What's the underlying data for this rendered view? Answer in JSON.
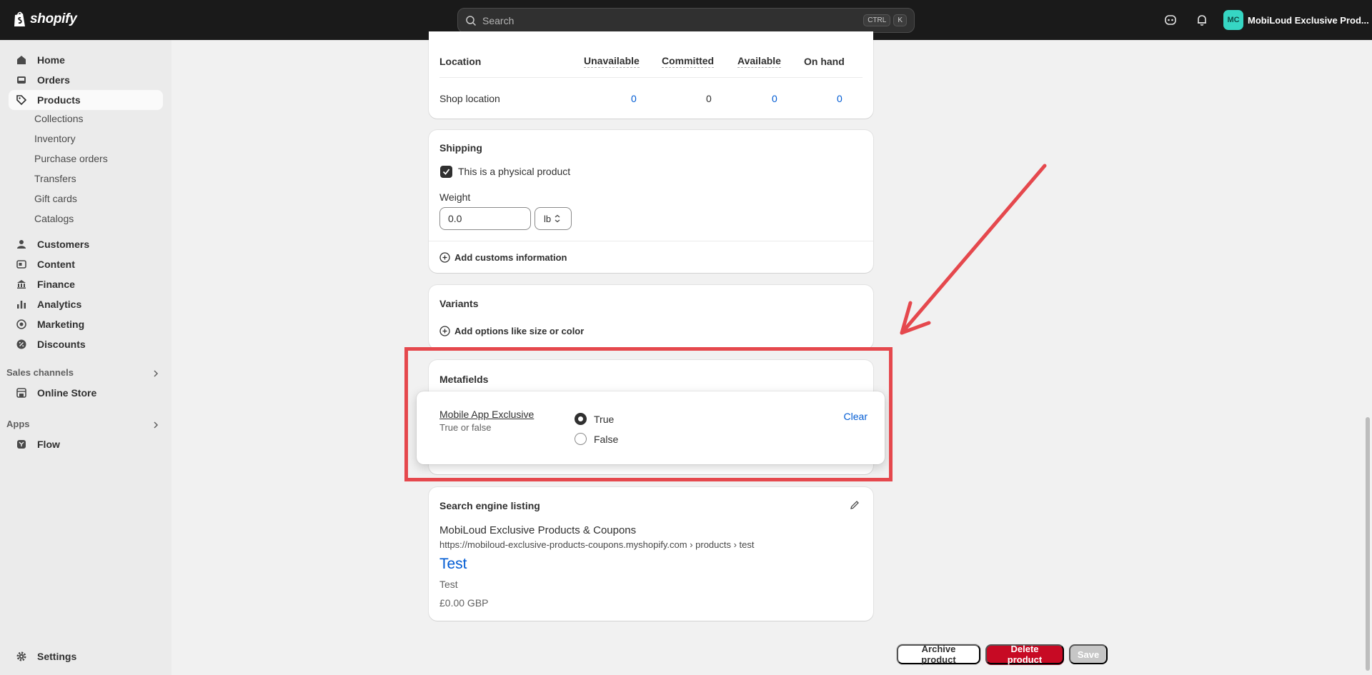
{
  "topbar": {
    "brand": "shopify",
    "search_placeholder": "Search",
    "shortcut_ctrl": "CTRL",
    "shortcut_k": "K",
    "avatar_initials": "MC",
    "store_name": "MobiLoud Exclusive Prod..."
  },
  "sidebar": {
    "home": "Home",
    "orders": "Orders",
    "products": "Products",
    "product_sub": [
      "Collections",
      "Inventory",
      "Purchase orders",
      "Transfers",
      "Gift cards",
      "Catalogs"
    ],
    "customers": "Customers",
    "content": "Content",
    "finance": "Finance",
    "analytics": "Analytics",
    "marketing": "Marketing",
    "discounts": "Discounts",
    "sales_channels": "Sales channels",
    "online_store": "Online Store",
    "apps": "Apps",
    "flow": "Flow",
    "settings": "Settings"
  },
  "inventory": {
    "col_location": "Location",
    "col_unavailable": "Unavailable",
    "col_committed": "Committed",
    "col_available": "Available",
    "col_on_hand": "On hand",
    "row_location": "Shop location",
    "row_unavailable": "0",
    "row_committed": "0",
    "row_available": "0",
    "row_on_hand": "0"
  },
  "shipping": {
    "title": "Shipping",
    "physical_label": "This is a physical product",
    "physical_checked": true,
    "weight_label": "Weight",
    "weight_value": "0.0",
    "weight_unit": "lb",
    "customs_label": "Add customs information"
  },
  "variants": {
    "title": "Variants",
    "add_options": "Add options like size or color"
  },
  "metafields": {
    "title": "Metafields",
    "field_name": "Mobile App Exclusive",
    "field_type": "True or false",
    "option_true": "True",
    "option_false": "False",
    "selected": "True",
    "clear_label": "Clear"
  },
  "seo": {
    "title": "Search engine listing",
    "store_name": "MobiLoud Exclusive Products & Coupons",
    "url": "https://mobiloud-exclusive-products-coupons.myshopify.com › products › test",
    "page_title": "Test",
    "description": "Test",
    "price": "£0.00 GBP"
  },
  "footer": {
    "archive": "Archive product",
    "delete": "Delete product",
    "save": "Save"
  },
  "colors": {
    "annotation": "#e5484d",
    "link": "#005bd3",
    "danger": "#c70a24",
    "avatar": "#36d6c3"
  }
}
